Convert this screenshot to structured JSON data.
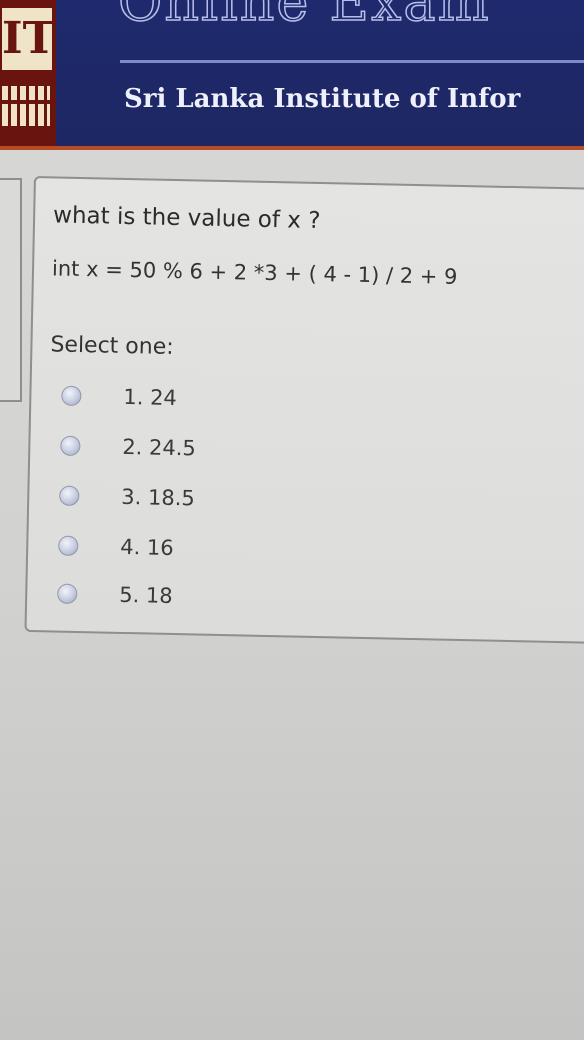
{
  "header": {
    "title_fragment": "Online Exam",
    "logo_text": "IT",
    "subtitle": "Sri Lanka Institute of Infor"
  },
  "question": {
    "prompt": "what is the value of x ?",
    "code": "int x = 50 % 6 + 2 *3 + ( 4 - 1) / 2 + 9",
    "select_label": "Select one:",
    "options": [
      {
        "label": "1. 24",
        "selected": false
      },
      {
        "label": "2. 24.5",
        "selected": false
      },
      {
        "label": "3. 18.5",
        "selected": false
      },
      {
        "label": "4. 16",
        "selected": false
      },
      {
        "label": "5. 18",
        "selected": false
      }
    ]
  },
  "colors": {
    "header_bg": "#1f2a6e",
    "accent": "#b74b26",
    "logo_bg": "#6a1410"
  }
}
